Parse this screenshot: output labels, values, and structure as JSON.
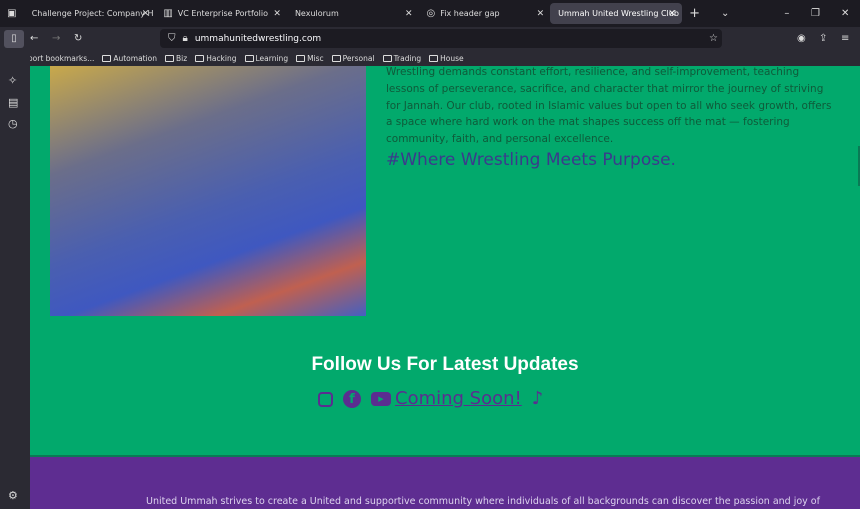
{
  "browser": {
    "tabs": [
      {
        "label": "Challenge Project: Company H"
      },
      {
        "label": "VC Enterprise Portfolio"
      },
      {
        "label": "Nexulorum"
      },
      {
        "label": "Fix header gap"
      },
      {
        "label": "Ummah United Wrestling Club",
        "active": true
      }
    ],
    "url": "ummahunitedwrestling.com",
    "bookmarks": [
      "Import bookmarks...",
      "Automation",
      "Biz",
      "Hacking",
      "Learning",
      "Misc",
      "Personal",
      "Trading",
      "House"
    ]
  },
  "page": {
    "paragraph": "Wrestling demands constant effort, resilience, and self-improvement, teaching lessons of perseverance, sacrifice, and character that mirror the journey of striving for Jannah. Our club, rooted in Islamic values but open to all who seek growth, offers a space where hard work on the mat shapes success off the mat — fostering community, faith, and personal excellence.",
    "tagline": "#Where Wrestling Meets Purpose.",
    "follow_heading": "Follow Us For Latest Updates",
    "youtube_label": "Coming Soon!",
    "footer_text": "United Ummah strives to create a United and supportive community where individuals of all backgrounds can discover the passion and joy of"
  },
  "colors": {
    "green": "#02a96c",
    "purple": "#5e2d91"
  }
}
